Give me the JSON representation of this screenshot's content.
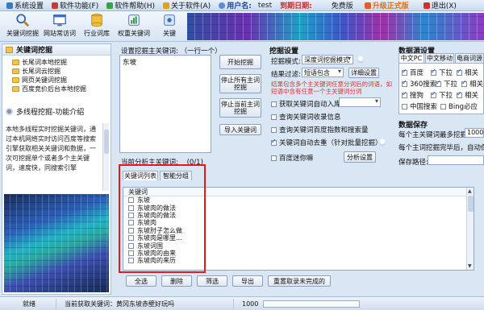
{
  "menubar": {
    "items": [
      {
        "label": "系统设置",
        "icon": "settings-icon",
        "color": "#3a78c8"
      },
      {
        "label": "软件功能(F)",
        "icon": "function-icon",
        "color": "#c83a3a"
      },
      {
        "label": "软件帮助(H)",
        "icon": "help-icon",
        "color": "#3aa04a"
      },
      {
        "label": "关于软件(A)",
        "icon": "about-icon",
        "color": "#e0a020"
      }
    ],
    "user_label": "用户名:",
    "user_value": "test",
    "expire_label": "到期日期:",
    "plan": "免费版",
    "upgrade": "升级正式版",
    "exit_label": "退出(X)"
  },
  "toolbar": {
    "buttons": [
      {
        "label": "关键词挖掘",
        "icon": "magnifier-icon"
      },
      {
        "label": "网站常访词",
        "icon": "website-icon"
      },
      {
        "label": "行业词库",
        "icon": "database-icon"
      },
      {
        "label": "权重关键词",
        "icon": "weight-icon"
      },
      {
        "label": "关键",
        "icon": "partial-icon"
      }
    ]
  },
  "left_panel": {
    "header": "关键词挖掘",
    "items": [
      "长尾词本地挖掘",
      "长尾词云挖掘",
      "网页关键词挖掘",
      "百度竞价后台本地挖掘"
    ],
    "multi_header": "多线程挖掘-功能介绍",
    "description": "本地多线程实时挖掘关键词，通过本机网络实时访问百度等搜索引擎获取相关关键词和数据，一次可挖掘单个或者多个主关键词，速度快，同搜索引擎"
  },
  "input_area": {
    "label": "设置挖掘主关键词: （一行一个）",
    "value": "东坡"
  },
  "buttons": {
    "start": "开始挖掘",
    "stop_all": "停止所有主词挖掘",
    "stop_current": "停止当前主词挖掘",
    "import": "导入关键词"
  },
  "current_progress": {
    "label": "当前分析主关键词:",
    "value": "(0/1)"
  },
  "tabs": {
    "keywords": "关键词列表",
    "smart_group": "智能分组"
  },
  "result_list": {
    "header": "关键词",
    "rows": [
      "东坡",
      "东坡肉的做法",
      "东坡肉的做法",
      "东坡肉",
      "东坡肘子怎么做",
      "东坡肉是哪里...",
      "东坡词国",
      "东坡肉的由来",
      "东坡肉的来历"
    ]
  },
  "bottom_buttons": [
    "全选",
    "删除",
    "筛选",
    "导出",
    "重置取录未完成的"
  ],
  "dig_settings": {
    "title": "挖掘设置",
    "mode_label": "挖掘模式:",
    "mode_value": "深度词挖掘模式",
    "filter_label": "结果过滤:",
    "filter_value": "短语包含",
    "detail_btn": "详细设置",
    "hint": "结果包含多个主关键词任意分词后的词语，如短语中含有任意一个主关键词分词",
    "options": [
      {
        "label": "获取关键词自动入库",
        "checked": false
      },
      {
        "label": "查询关键词收录信息",
        "checked": false
      },
      {
        "label": "查询关键词百度指数和搜索量",
        "checked": false
      },
      {
        "label": "关键词自动去重（针对批量挖掘）",
        "checked": true
      },
      {
        "label": "百度迷你嘛",
        "checked": false
      }
    ],
    "analyze_btn": "分析设置"
  },
  "data_source": {
    "title": "数据源设置",
    "tabs": [
      "中文PC",
      "中文移动",
      "电商词源"
    ],
    "rows": [
      [
        {
          "label": "百度",
          "checked": true
        },
        {
          "label": "下拉",
          "checked": true
        },
        {
          "label": "相关",
          "checked": true
        }
      ],
      [
        {
          "label": "360搜索",
          "checked": true
        },
        {
          "label": "下拉",
          "checked": true
        },
        {
          "label": "相关",
          "checked": true
        }
      ],
      [
        {
          "label": "搜狗",
          "checked": true
        },
        {
          "label": "下拉",
          "checked": true
        },
        {
          "label": "相关",
          "checked": true
        }
      ],
      [
        {
          "label": "中国搜索",
          "checked": false
        },
        {
          "label": "Bing必应",
          "checked": false
        }
      ]
    ]
  },
  "data_save": {
    "title": "数据保存",
    "max_label": "每个主关键词最多挖掘:",
    "max_value": "1000",
    "auto_label": "每个主词挖掘完毕后，自动保",
    "path_label": "保存路径:"
  },
  "statusbar": {
    "ready": "就绪",
    "current": "当前获取关键词：黄冈东坡赤壁好玩吗",
    "count": "1000"
  }
}
